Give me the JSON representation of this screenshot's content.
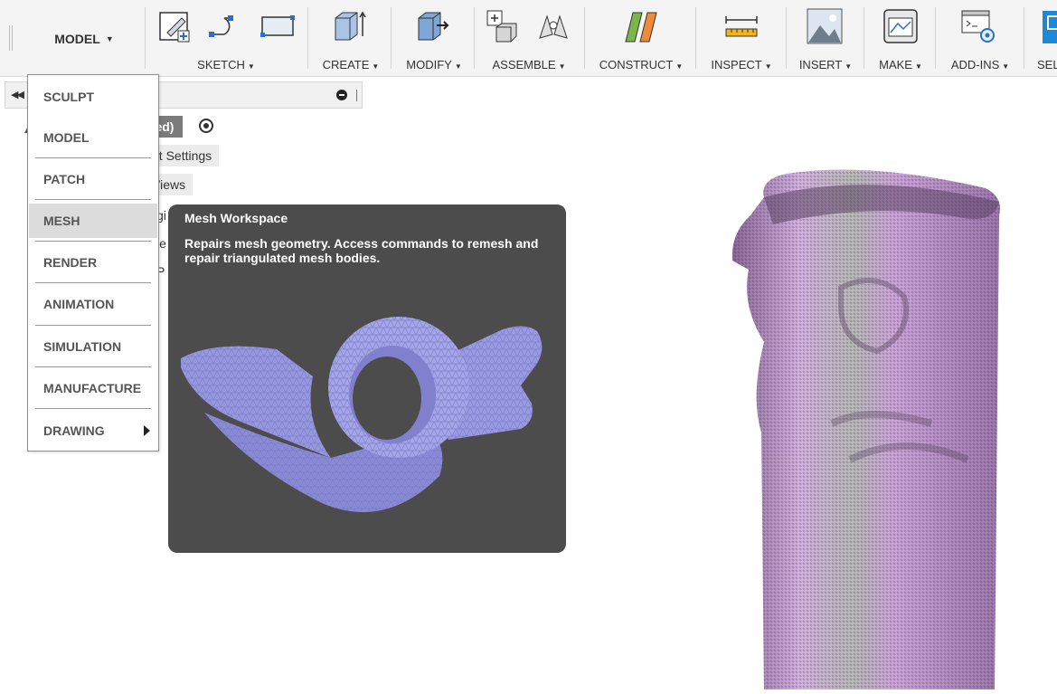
{
  "toolbar": {
    "workspace": "MODEL",
    "groups": [
      "SKETCH",
      "CREATE",
      "MODIFY",
      "ASSEMBLE",
      "CONSTRUCT",
      "INSPECT",
      "INSERT",
      "MAKE",
      "ADD-INS",
      "SEL"
    ]
  },
  "browser": {
    "document_frag": "red)",
    "row2": "nt Settings",
    "row3": "Views",
    "frag1": "gi",
    "frag2": "ie",
    "frag3": "P"
  },
  "workspace_menu": {
    "items": [
      "SCULPT",
      "MODEL",
      "PATCH",
      "MESH",
      "RENDER",
      "ANIMATION",
      "SIMULATION",
      "MANUFACTURE",
      "DRAWING"
    ],
    "selected": "MESH"
  },
  "tooltip": {
    "title": "Mesh Workspace",
    "description": "Repairs mesh geometry. Access commands to remesh and repair triangulated mesh bodies."
  },
  "colors": {
    "tooltip_bg": "#4c4c4c",
    "mesh_body": "#b58fc4",
    "mesh_preview": "#9898e0",
    "menu_highlight": "#dcdcdc"
  }
}
